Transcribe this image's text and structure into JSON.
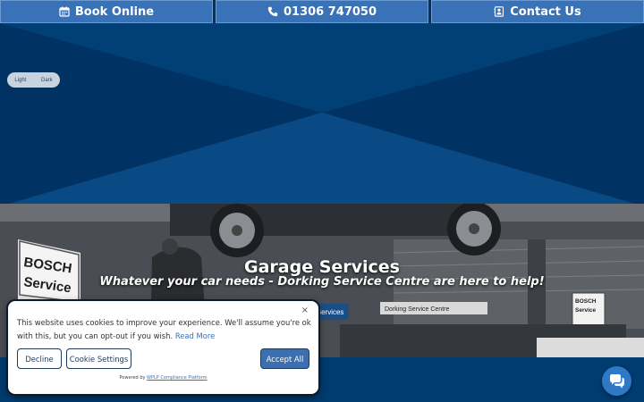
{
  "topbar": {
    "book_label": "Book Online",
    "phone_label": "01306 747050",
    "contact_label": "Contact Us"
  },
  "theme_toggle": {
    "light_label": "Light",
    "dark_label": "Dark"
  },
  "banner": {
    "title": "Garage Services",
    "subtitle": "Whatever your car needs - Dorking Service Centre are here to help!",
    "breadcrumb_current": "Garage Services",
    "sign_left_brand": "BOSCH",
    "sign_left_service": "Service",
    "sign_right_brand": "BOSCH",
    "sign_right_service": "Service",
    "shop_sign": "Dorking Service Centre"
  },
  "cookie": {
    "close_symbol": "×",
    "message": "This website uses cookies to improve your experience. We'll assume you're ok with this, but you can opt-out if you wish.",
    "read_more": "Read More",
    "decline_label": "Decline",
    "settings_label": "Cookie Settings",
    "accept_label": "Accept All",
    "powered_prefix": "Powered by",
    "powered_link": "WPLP Compliance Platform"
  },
  "colors": {
    "navy": "#003a6b",
    "button_blue": "#3a72b8",
    "accept_blue": "#3b6fb0"
  },
  "icons": {
    "book": "calendar-icon",
    "phone": "phone-icon",
    "contact": "contact-card-icon",
    "chat": "chat-icon"
  }
}
